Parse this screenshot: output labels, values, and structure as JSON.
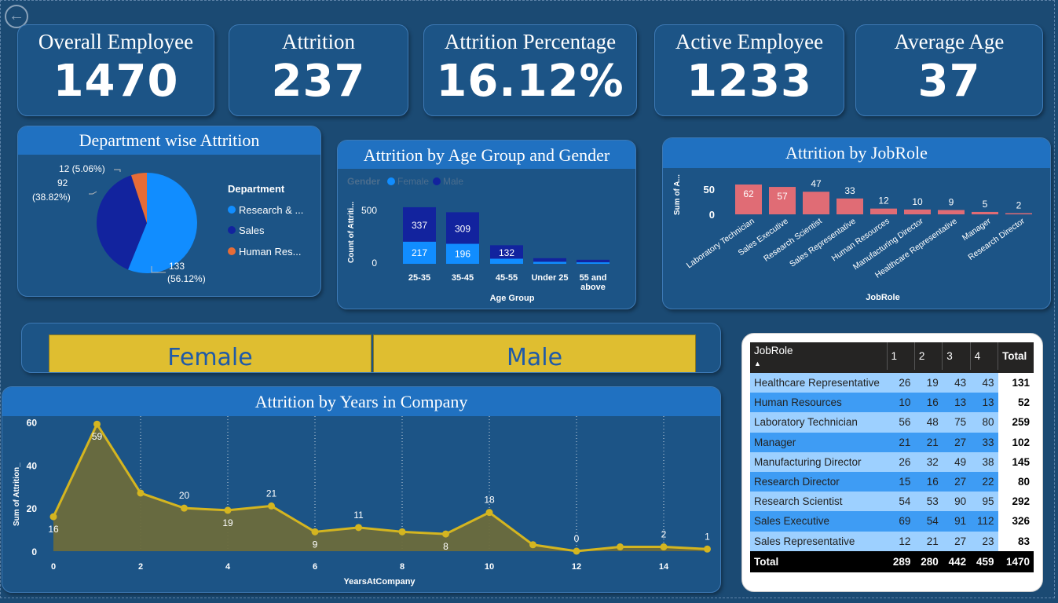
{
  "kpis": [
    {
      "title": "Overall Employee",
      "value": "1470"
    },
    {
      "title": "Attrition",
      "value": "237"
    },
    {
      "title": "Attrition Percentage",
      "value": "16.12%"
    },
    {
      "title": "Active Employee",
      "value": "1233"
    },
    {
      "title": "Average Age",
      "value": "37"
    }
  ],
  "dept": {
    "title": "Department wise Attrition",
    "legend_title": "Department",
    "legend": [
      "Research & ...",
      "Sales",
      "Human Res..."
    ],
    "labels": [
      "133",
      "(56.12%)",
      "92",
      "(38.82%)",
      "12 (5.06%)"
    ]
  },
  "age": {
    "title": "Attrition by Age Group and Gender",
    "legend_title": "Gender",
    "legend": [
      "Female",
      "Male"
    ],
    "ylabel": "Count of Attriti...",
    "xlabel": "Age Group",
    "yticks": [
      "500",
      "0"
    ]
  },
  "job": {
    "title": "Attrition by JobRole",
    "ylabel": "Sum of A...",
    "xlabel": "JobRole",
    "yticks": [
      "50",
      "0"
    ]
  },
  "slicer": {
    "female": "Female",
    "male": "Male"
  },
  "years": {
    "title": "Attrition by Years in Company",
    "ylabel": "Sum of Attrition_",
    "xlabel": "YearsAtCompany"
  },
  "table": {
    "headers": [
      "JobRole",
      "1",
      "2",
      "3",
      "4",
      "Total"
    ],
    "rows": [
      [
        "Healthcare Representative",
        "26",
        "19",
        "43",
        "43",
        "131"
      ],
      [
        "Human Resources",
        "10",
        "16",
        "13",
        "13",
        "52"
      ],
      [
        "Laboratory Technician",
        "56",
        "48",
        "75",
        "80",
        "259"
      ],
      [
        "Manager",
        "21",
        "21",
        "27",
        "33",
        "102"
      ],
      [
        "Manufacturing Director",
        "26",
        "32",
        "49",
        "38",
        "145"
      ],
      [
        "Research Director",
        "15",
        "16",
        "27",
        "22",
        "80"
      ],
      [
        "Research Scientist",
        "54",
        "53",
        "90",
        "95",
        "292"
      ],
      [
        "Sales Executive",
        "69",
        "54",
        "91",
        "112",
        "326"
      ],
      [
        "Sales Representative",
        "12",
        "21",
        "27",
        "23",
        "83"
      ]
    ],
    "total": [
      "Total",
      "289",
      "280",
      "442",
      "459",
      "1470"
    ]
  },
  "colors": {
    "blue": "#118dff",
    "navy": "#12239e",
    "orange": "#e66c37",
    "salmon": "#e06c75",
    "gold": "#d4b520",
    "slicer": "#dfbe30"
  },
  "chart_data": [
    {
      "type": "pie",
      "title": "Department wise Attrition",
      "categories": [
        "Research & Development",
        "Sales",
        "Human Resources"
      ],
      "values": [
        133,
        92,
        12
      ],
      "percent": [
        56.12,
        38.82,
        5.06
      ]
    },
    {
      "type": "bar",
      "title": "Attrition by Age Group and Gender",
      "categories": [
        "25-35",
        "35-45",
        "45-55",
        "Under 25",
        "55 and above"
      ],
      "series": [
        {
          "name": "Female",
          "values": [
            217,
            196,
            50,
            20,
            15
          ]
        },
        {
          "name": "Male",
          "values": [
            337,
            309,
            132,
            35,
            25
          ]
        }
      ],
      "ylim": [
        0,
        600
      ]
    },
    {
      "type": "bar",
      "title": "Attrition by JobRole",
      "categories": [
        "Laboratory Technician",
        "Sales Executive",
        "Research Scientist",
        "Sales Representative",
        "Human Resources",
        "Manufacturing Director",
        "Healthcare Representative",
        "Manager",
        "Research Director"
      ],
      "values": [
        62,
        57,
        47,
        33,
        12,
        10,
        9,
        5,
        2
      ],
      "ylim": [
        0,
        70
      ]
    },
    {
      "type": "area",
      "title": "Attrition by Years in Company",
      "x": [
        0,
        1,
        2,
        3,
        4,
        5,
        6,
        7,
        8,
        9,
        10,
        11,
        12,
        13,
        14,
        15
      ],
      "values": [
        16,
        59,
        27,
        20,
        19,
        21,
        9,
        11,
        9,
        8,
        18,
        3,
        0,
        2,
        2,
        1
      ],
      "labeled": [
        0,
        1,
        3,
        4,
        5,
        6,
        7,
        9,
        10,
        12,
        14,
        15
      ],
      "xticks": [
        0,
        2,
        4,
        6,
        8,
        10,
        12,
        14
      ],
      "yticks": [
        0,
        20,
        40,
        60
      ],
      "ylim": [
        0,
        62
      ]
    }
  ]
}
